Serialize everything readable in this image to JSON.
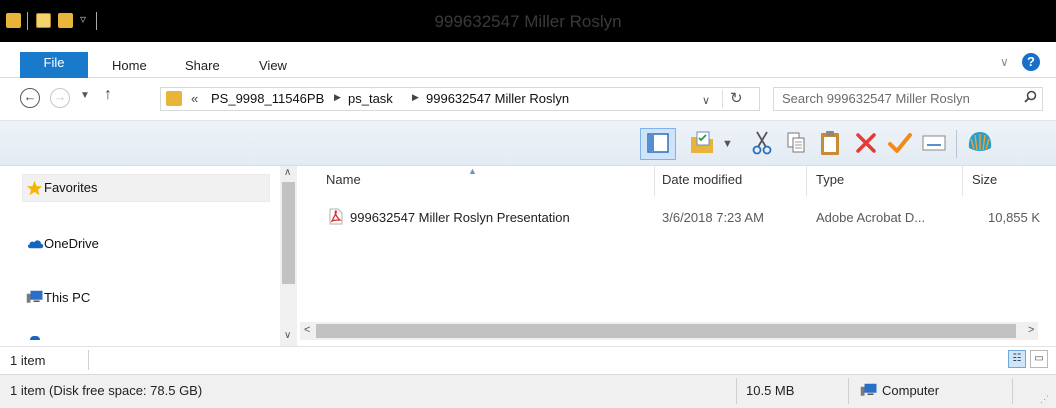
{
  "window": {
    "title": "999632547 Miller Roslyn"
  },
  "ribbon": {
    "tabs": [
      {
        "label": "File"
      },
      {
        "label": "Home"
      },
      {
        "label": "Share"
      },
      {
        "label": "View"
      }
    ],
    "help_label": "?"
  },
  "address": {
    "overflow": "«",
    "crumbs": [
      {
        "label": "PS_9998_11546PB"
      },
      {
        "label": "ps_task"
      },
      {
        "label": "999632547 Miller Roslyn"
      }
    ],
    "search_placeholder": "Search 999632547 Miller Roslyn"
  },
  "nav": {
    "items": [
      {
        "label": "Favorites",
        "icon": "star-icon"
      },
      {
        "label": "OneDrive",
        "icon": "cloud-icon"
      },
      {
        "label": "This PC",
        "icon": "computer-icon"
      }
    ]
  },
  "file_list": {
    "columns": [
      {
        "label": "Name"
      },
      {
        "label": "Date modified"
      },
      {
        "label": "Type"
      },
      {
        "label": "Size"
      }
    ],
    "rows": [
      {
        "name": "999632547 Miller Roslyn Presentation",
        "date_modified": "3/6/2018 7:23 AM",
        "type": "Adobe Acrobat D...",
        "size": "10,855 K",
        "icon": "pdf-icon"
      }
    ]
  },
  "status": {
    "item_count": "1 item",
    "disk_info": "1 item (Disk free space: 78.5 GB)",
    "selection_size": "10.5 MB",
    "location": "Computer"
  },
  "colors": {
    "accent": "#1979ca",
    "titlebar": "#000000",
    "delete_red": "#e53935",
    "check_orange": "#f08a1c"
  }
}
